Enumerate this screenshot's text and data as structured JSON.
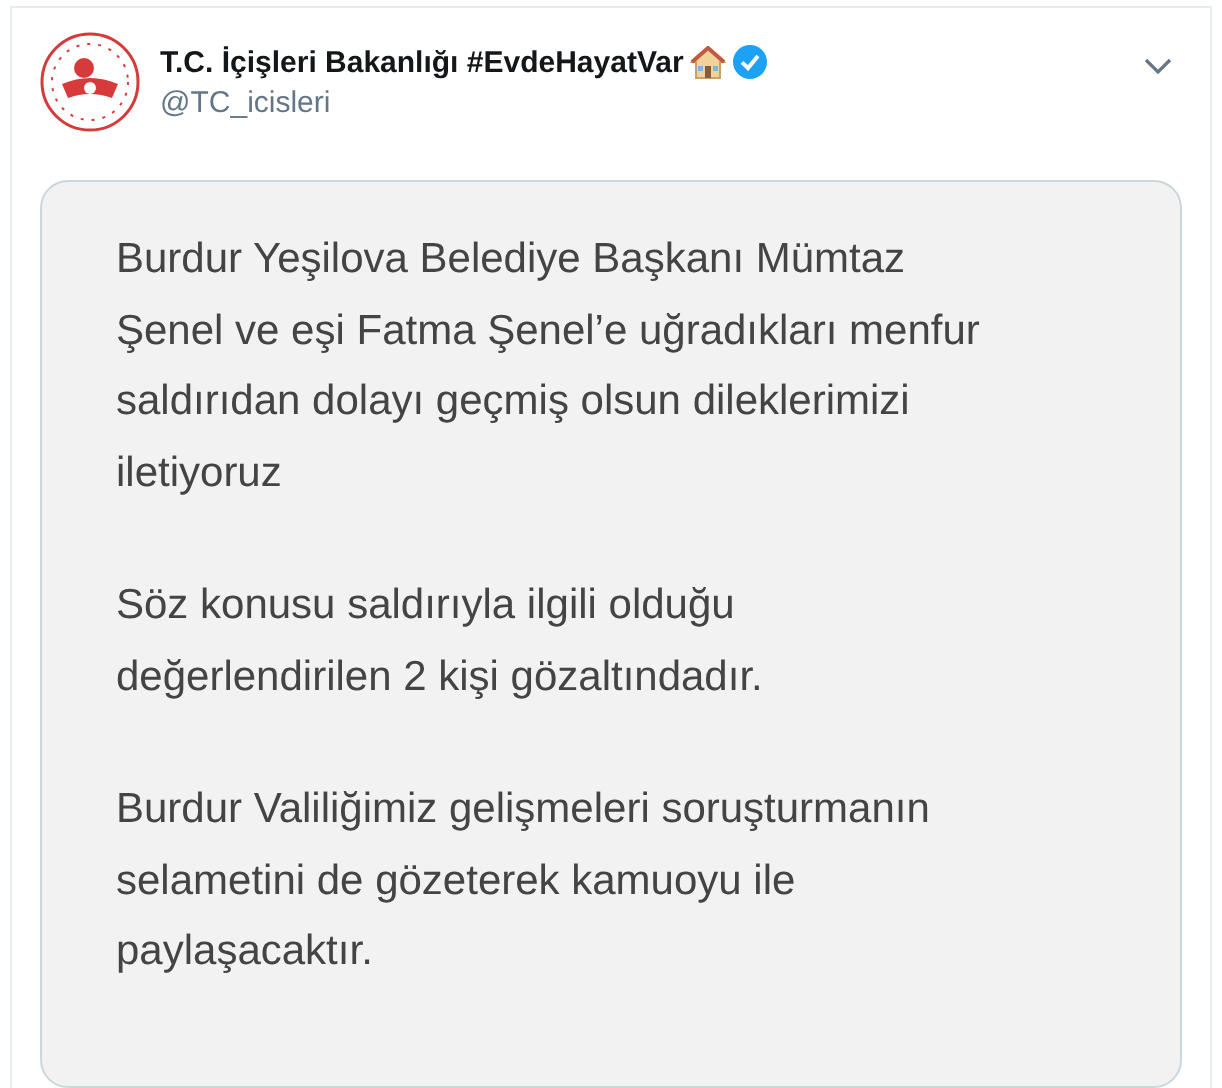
{
  "tweet": {
    "author_name": "T.C. İçişleri Bakanlığı #EvdeHayatVar",
    "verified": true,
    "handle": "@TC_icisleri",
    "image_text": [
      {
        "lines": [
          "Burdur Yeşilova Belediye Başkanı Mümtaz",
          "Şenel ve eşi Fatma Şenel’e uğradıkları menfur",
          "saldırıdan dolayı geçmiş olsun dileklerimizi",
          "iletiyoruz"
        ]
      },
      {
        "lines": [
          "Söz konusu saldırıyla ilgili olduğu",
          "değerlendirilen 2 kişi gözaltındadır."
        ]
      },
      {
        "lines": [
          "Burdur Valiliğimiz gelişmeleri soruşturmanın",
          "selametini de gözeterek kamuoyu ile",
          "paylaşacaktır."
        ]
      }
    ]
  }
}
